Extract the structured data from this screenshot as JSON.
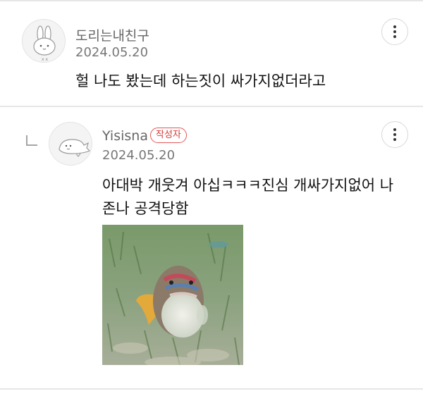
{
  "comments": [
    {
      "author": "도리는내친구",
      "date": "2024.05.20",
      "text": "헐 나도 봤는데 하는짓이 싸가지없더라고",
      "avatar_icon": "bunny-avatar-icon",
      "menu_icon": "more-vertical-icon"
    },
    {
      "author": "Yisisna",
      "badge": "작성자",
      "date": "2024.05.20",
      "text_line1": "아대박 개웃겨 아십ㅋㅋㅋ진심 개싸가지없어 나",
      "text_line2": "존나 공격당함",
      "avatar_icon": "seal-avatar-icon",
      "menu_icon": "more-vertical-icon",
      "reply_icon": "reply-corner-icon",
      "image": "fish-photo"
    }
  ],
  "colors": {
    "badge": "#e15757",
    "divider": "#e6e6e6",
    "meta_text": "#777777"
  }
}
